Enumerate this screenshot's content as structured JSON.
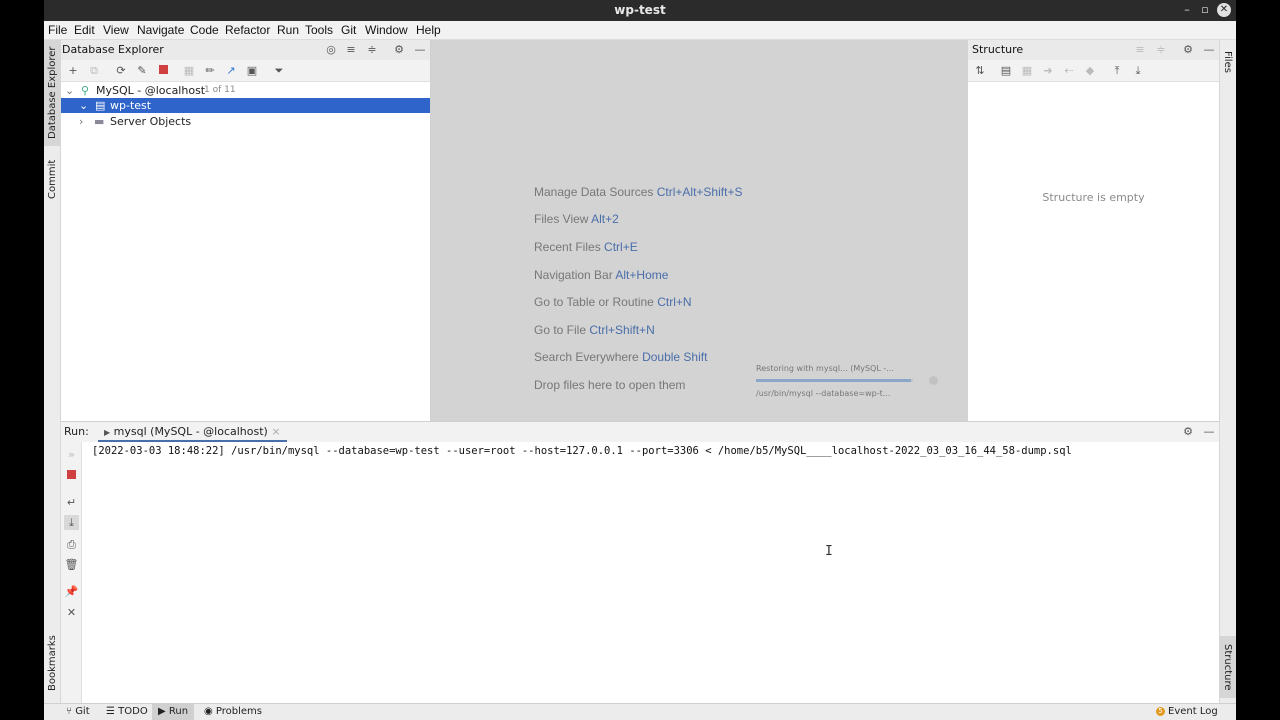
{
  "window": {
    "title": "wp-test",
    "min": "–",
    "max": "▫",
    "close": "✕"
  },
  "menu": [
    "File",
    "Edit",
    "View",
    "Navigate",
    "Code",
    "Refactor",
    "Run",
    "Tools",
    "Git",
    "Window",
    "Help"
  ],
  "left_strip": {
    "db_explorer": "Database Explorer",
    "commit": "Commit",
    "bookmarks": "Bookmarks"
  },
  "right_strip": {
    "files": "Files",
    "structure": "Structure"
  },
  "db_explorer": {
    "title": "Database Explorer",
    "tree": {
      "root": {
        "label": "MySQL - @localhost",
        "count": "1 of 11"
      },
      "schema": {
        "label": "wp-test"
      },
      "server_objects": {
        "label": "Server Objects"
      }
    }
  },
  "editor_hints": [
    {
      "text": "Manage Data Sources",
      "shortcut": "Ctrl+Alt+Shift+S"
    },
    {
      "text": "Files View",
      "shortcut": "Alt+2"
    },
    {
      "text": "Recent Files",
      "shortcut": "Ctrl+E"
    },
    {
      "text": "Navigation Bar",
      "shortcut": "Alt+Home"
    },
    {
      "text": "Go to Table or Routine",
      "shortcut": "Ctrl+N"
    },
    {
      "text": "Go to File",
      "shortcut": "Ctrl+Shift+N"
    },
    {
      "text": "Search Everywhere",
      "shortcut": "Double Shift"
    },
    {
      "text": "Drop files here to open them",
      "shortcut": ""
    }
  ],
  "progress": {
    "title": "Restoring with mysql... (MySQL -...",
    "detail": "/usr/bin/mysql --database=wp-t...",
    "fraction": 0.99
  },
  "structure": {
    "title": "Structure",
    "empty": "Structure is empty"
  },
  "run": {
    "label": "Run:",
    "tab": "mysql (MySQL - @localhost)",
    "tab_close": "×",
    "console_line": "[2022-03-03 18:48:22] /usr/bin/mysql --database=wp-test --user=root --host=127.0.0.1 --port=3306 < /home/b5/MySQL____localhost-2022_03_03_16_44_58-dump.sql"
  },
  "statusbar": {
    "git": "Git",
    "todo": "TODO",
    "run": "Run",
    "problems": "Problems",
    "event_log": "Event Log",
    "event_badge": "5"
  }
}
